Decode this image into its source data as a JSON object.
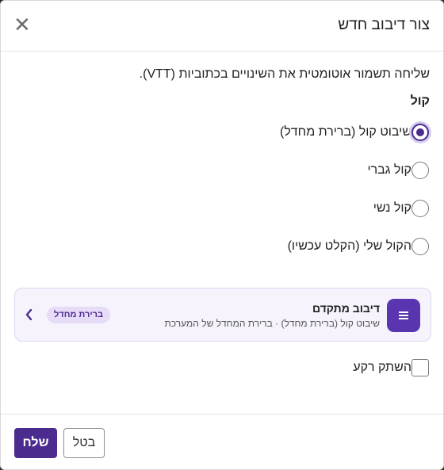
{
  "dialog": {
    "title": "צור דיבוב חדש",
    "close_icon": "close-icon",
    "description": "שליחה תשמור אוטומטית את השינויים בכתוביות (VTT).",
    "voice_label": "קול",
    "voice_options": [
      {
        "label": "שיבוט קול (ברירת מחדל)",
        "checked": true
      },
      {
        "label": "קול גברי",
        "checked": false
      },
      {
        "label": "קול נשי",
        "checked": false
      },
      {
        "label": "הקול שלי (הקלט עכשיו)",
        "checked": false
      }
    ],
    "advanced": {
      "title": "דיבוב מתקדם",
      "subtitle": "שיבוט קול (ברירת מחדל) · ברירת המחדל של המערכת",
      "badge": "ברירת מחדל",
      "icon": "list-icon",
      "chevron_icon": "chevron-left-icon"
    },
    "mute_background": {
      "label": "השתק רקע",
      "checked": false
    },
    "buttons": {
      "send": "שלח",
      "cancel": "בטל"
    },
    "colors": {
      "accent": "#4c2b8f",
      "card_bg": "#f6f3fd",
      "badge_bg": "#e7dcf8"
    }
  }
}
